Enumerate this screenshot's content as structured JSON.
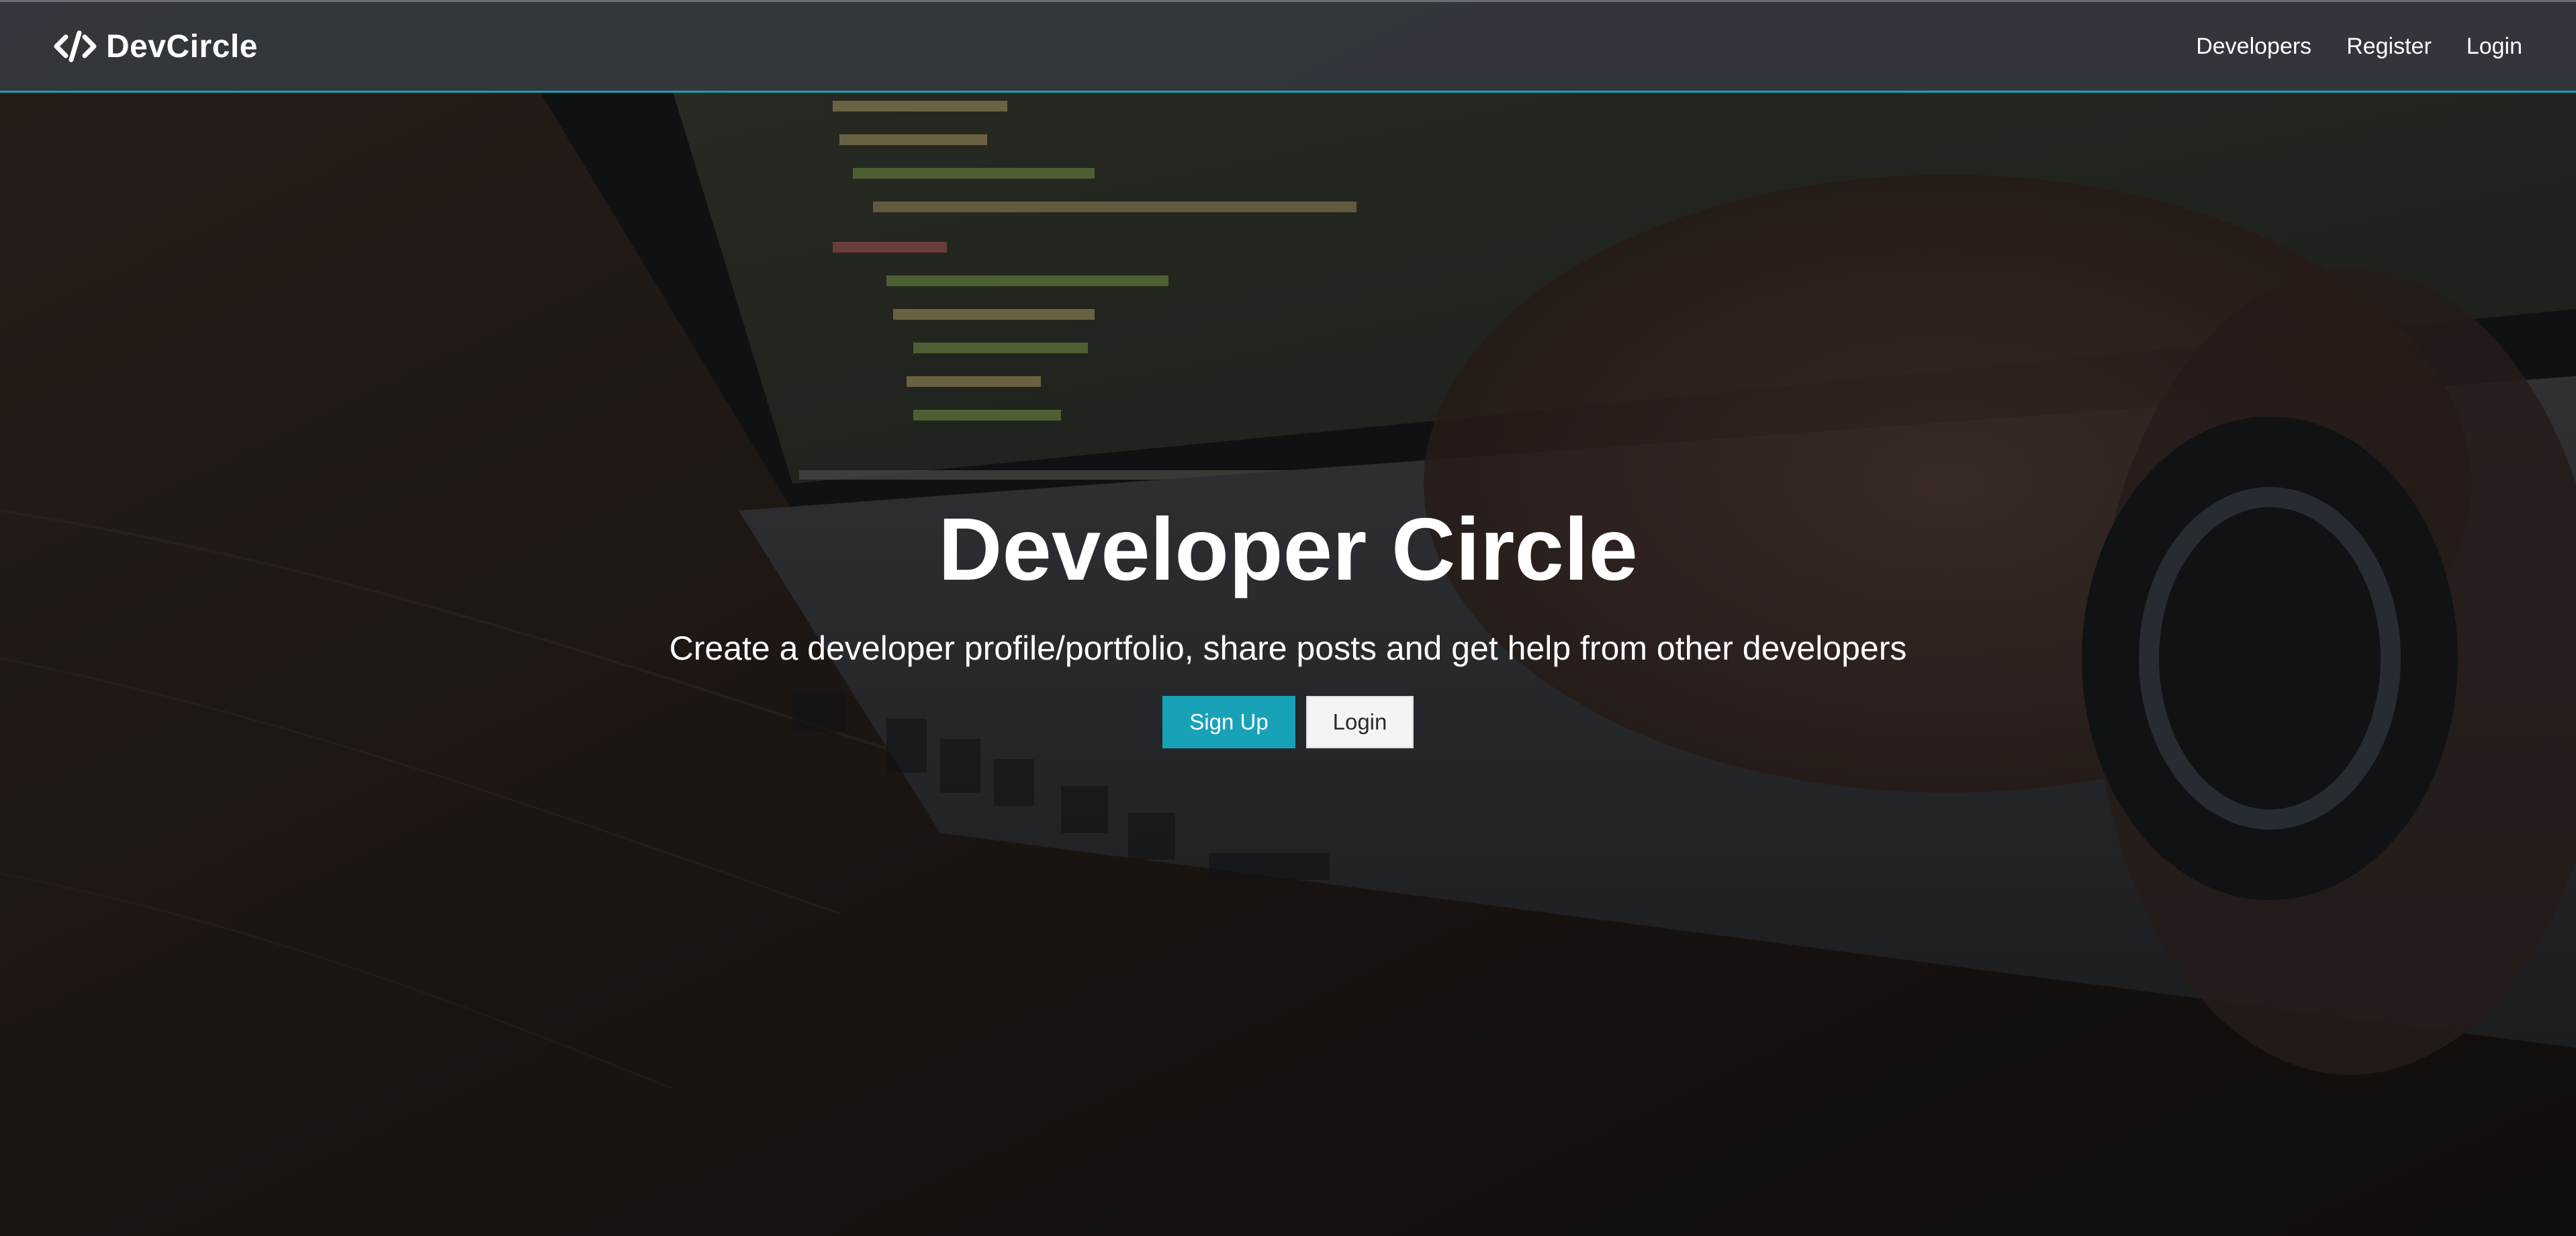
{
  "navbar": {
    "brand_name": "DevCircle",
    "brand_icon": "code-icon",
    "links": [
      {
        "label": "Developers"
      },
      {
        "label": "Register"
      },
      {
        "label": "Login"
      }
    ],
    "accent_color": "#17a2b8"
  },
  "hero": {
    "title": "Developer Circle",
    "lead": "Create a developer profile/portfolio, share posts and get help from other developers",
    "signup_label": "Sign Up",
    "login_label": "Login"
  },
  "background": {
    "description_icon": "laptop-code-photo"
  },
  "colors": {
    "primary": "#17a2b8",
    "navbar": "#343a40",
    "light_button": "#f4f4f4"
  }
}
